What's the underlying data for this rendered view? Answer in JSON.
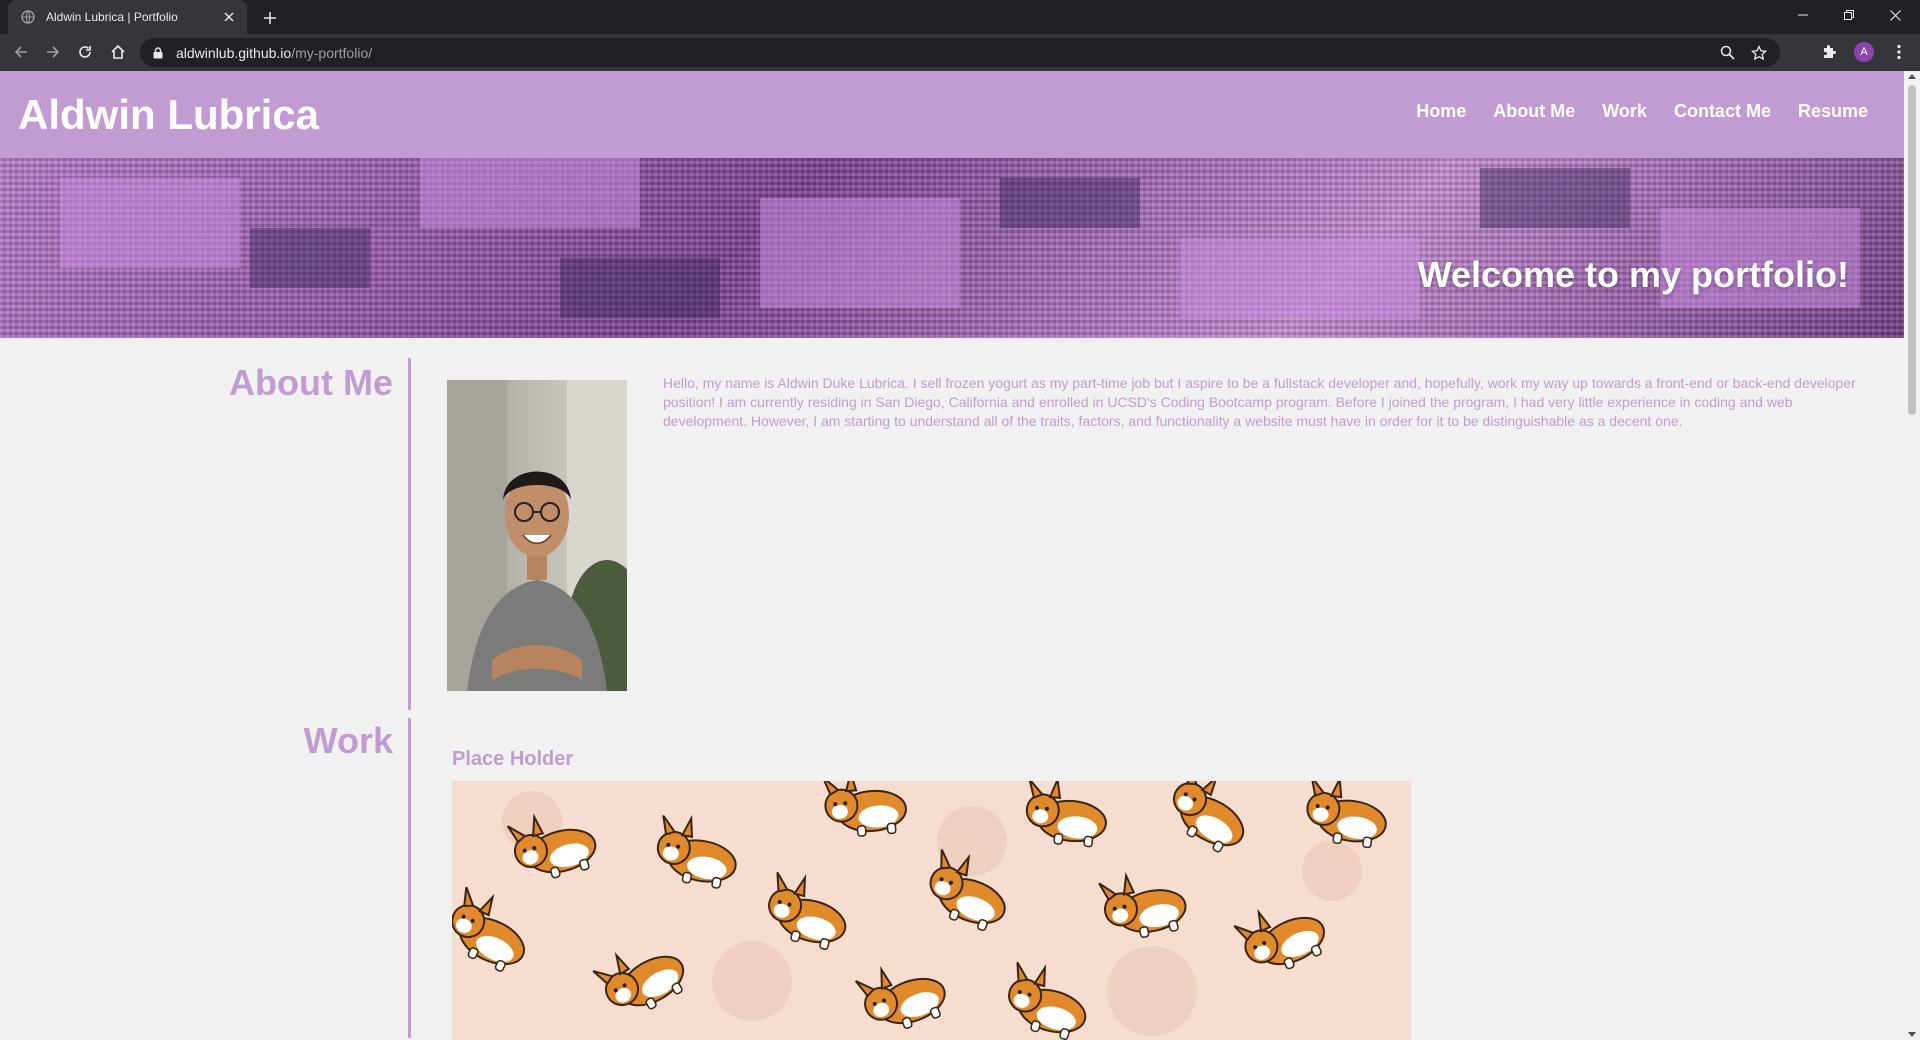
{
  "browser": {
    "tab_title": "Aldwin Lubrica | Portfolio",
    "url_host": "aldwinlub.github.io",
    "url_path": "/my-portfolio/",
    "profile_initial": "A"
  },
  "site": {
    "name": "Aldwin Lubrica",
    "nav": {
      "home": "Home",
      "about": "About Me",
      "work": "Work",
      "contact": "Contact Me",
      "resume": "Resume"
    },
    "hero_title": "Welcome to my portfolio!",
    "about": {
      "heading": "About Me",
      "text": "Hello, my name is Aldwin Duke Lubrica. I sell frozen yogurt as my part-time job but I aspire to be a fullstack developer and, hopefully, work my way up towards a front-end or back-end developer position! I am currently residing in San Diego, California and enrolled in UCSD's Coding Bootcamp program. Before I joined the program, I had very little experience in coding and web development. However, I am starting to understand all of the traits, factors, and functionality a website must have in order for it to be distinguishable as a decent one."
    },
    "work": {
      "heading": "Work",
      "item_title": "Place Holder"
    }
  },
  "colors": {
    "accent": "#c39bd3",
    "chrome_dark": "#202124",
    "chrome_toolbar": "#35363a"
  }
}
